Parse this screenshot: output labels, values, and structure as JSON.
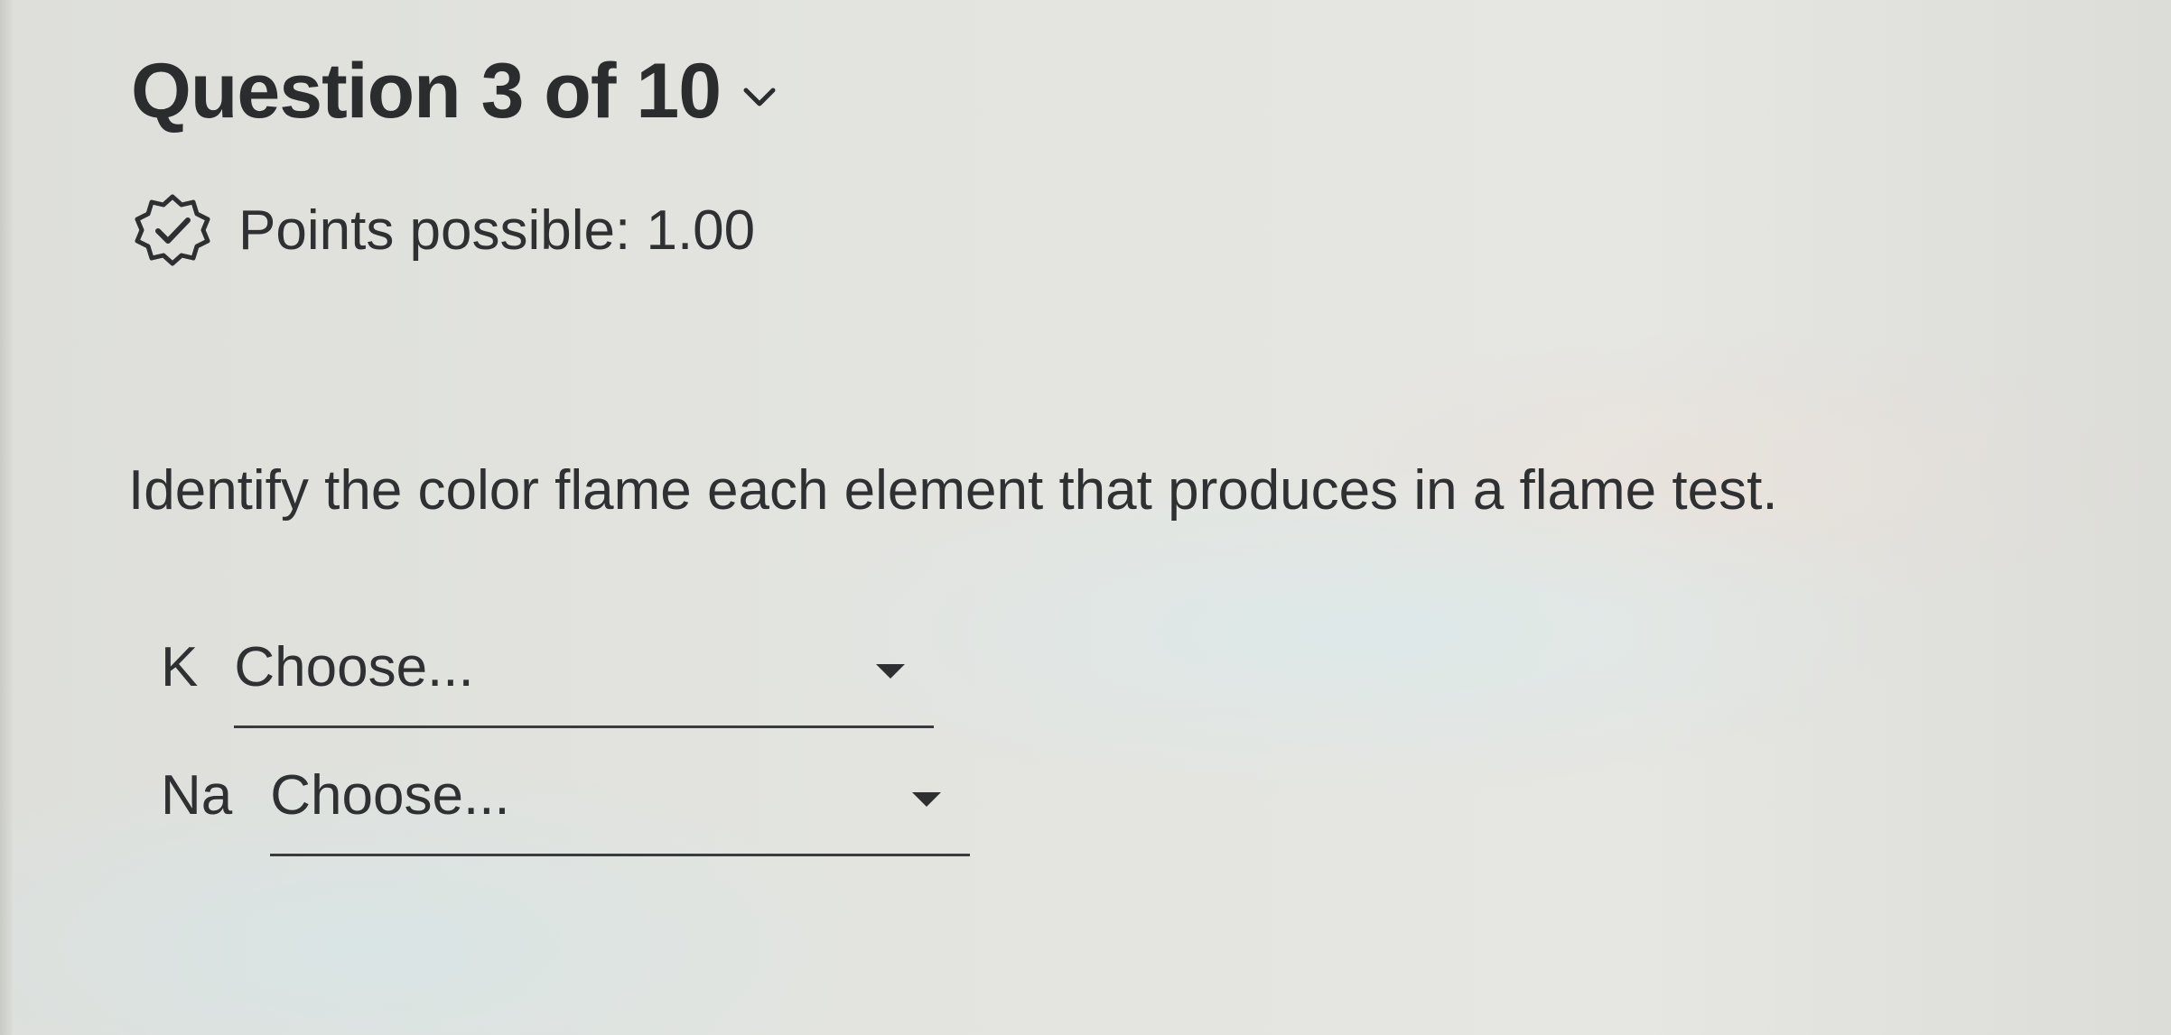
{
  "header": {
    "title": "Question 3 of 10",
    "expand_icon": "chevron-down-icon"
  },
  "points": {
    "icon": "verified-badge-icon",
    "label": "Points possible: 1.00"
  },
  "question": {
    "prompt": "Identify the color flame each element that produces in a flame test."
  },
  "answers": [
    {
      "element": "K",
      "selected": "Choose...",
      "icon": "caret-down-icon"
    },
    {
      "element": "Na",
      "selected": "Choose...",
      "icon": "caret-down-icon"
    }
  ],
  "colors": {
    "text": "#2f3032",
    "background": "#e3e4e0"
  }
}
